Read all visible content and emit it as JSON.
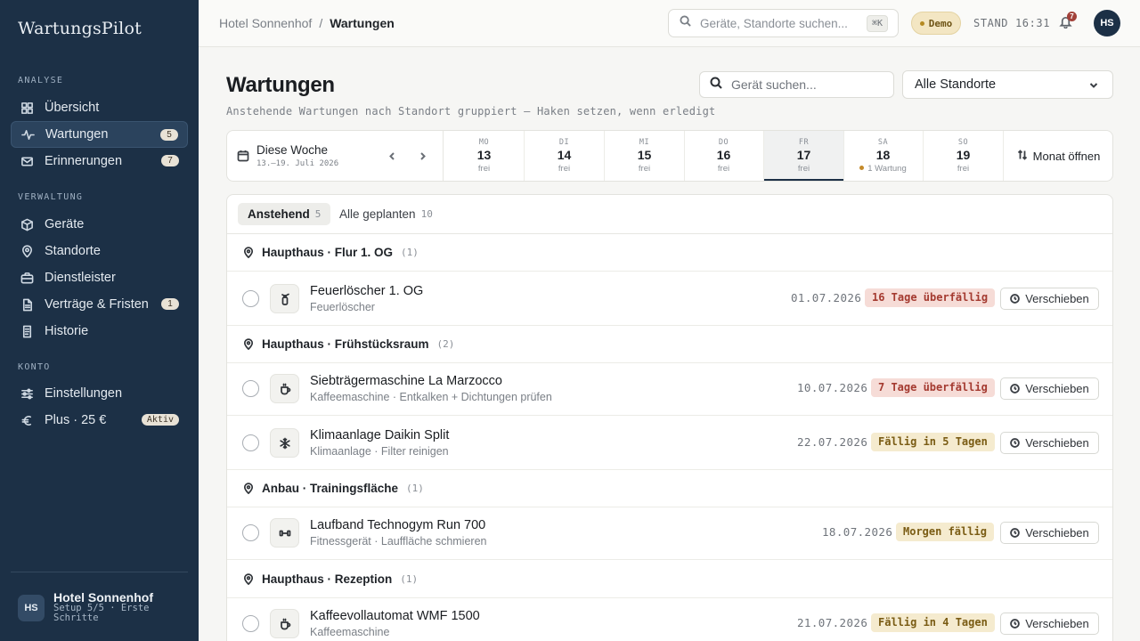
{
  "app": {
    "name": "WartungsPilot"
  },
  "sidebar": {
    "sections": [
      "ANALYSE",
      "VERWALTUNG",
      "KONTO"
    ],
    "items": [
      {
        "label": "Übersicht",
        "icon": "grid-icon"
      },
      {
        "label": "Wartungen",
        "icon": "activity-icon",
        "count": "5",
        "active": true
      },
      {
        "label": "Erinnerungen",
        "icon": "mail-icon",
        "count": "7"
      },
      {
        "label": "Geräte",
        "icon": "box-icon"
      },
      {
        "label": "Standorte",
        "icon": "map-pin-icon"
      },
      {
        "label": "Dienstleister",
        "icon": "briefcase-icon"
      },
      {
        "label": "Verträge & Fristen",
        "icon": "document-icon",
        "count": "1"
      },
      {
        "label": "Historie",
        "icon": "history-icon"
      },
      {
        "label": "Einstellungen",
        "icon": "sliders-icon"
      },
      {
        "label": "Plus · 25 €",
        "icon": "euro-icon",
        "pill": "Aktiv"
      }
    ],
    "user": {
      "initials": "HS",
      "name": "Hotel Sonnenhof",
      "sub": "Setup 5/5 · Erste Schritte"
    }
  },
  "topbar": {
    "breadcrumb": [
      "Hotel Sonnenhof",
      "/",
      "Wartungen"
    ],
    "search_placeholder": "Geräte, Standorte suchen...",
    "shortcut": "⌘K",
    "demo_label": "Demo",
    "status_time": "STAND 16:31",
    "notifications": "7",
    "avatar": "HS"
  },
  "page": {
    "title": "Wartungen",
    "subtitle": "Anstehende Wartungen nach Standort gruppiert — Haken setzen, wenn erledigt",
    "device_search_placeholder": "Gerät suchen...",
    "location_select": "Alle Standorte"
  },
  "week": {
    "label": "Diese Woche",
    "range": "13.–19. Juli 2026",
    "days": [
      {
        "wd": "MO",
        "num": "13",
        "status": "frei"
      },
      {
        "wd": "DI",
        "num": "14",
        "status": "frei"
      },
      {
        "wd": "MI",
        "num": "15",
        "status": "frei"
      },
      {
        "wd": "DO",
        "num": "16",
        "status": "frei"
      },
      {
        "wd": "FR",
        "num": "17",
        "status": "frei",
        "selected": true
      },
      {
        "wd": "SA",
        "num": "18",
        "status": "1 Wartung",
        "dot": true
      },
      {
        "wd": "SO",
        "num": "19",
        "status": "frei"
      }
    ],
    "month_button": "Monat öffnen"
  },
  "tabs": [
    {
      "label": "Anstehend",
      "count": "5",
      "active": true
    },
    {
      "label": "Alle geplanten",
      "count": "10"
    }
  ],
  "groups": [
    {
      "name": "Haupthaus · Flur 1. OG",
      "count": "(1)",
      "items": [
        {
          "name": "Feuerlöscher 1. OG",
          "desc": "Feuerlöscher",
          "icon": "fire-extinguisher-icon",
          "date": "01.07.2026",
          "due": "16 Tage überfällig",
          "tone": "red",
          "action": "Verschieben"
        }
      ]
    },
    {
      "name": "Haupthaus · Frühstücksraum",
      "count": "(2)",
      "items": [
        {
          "name": "Siebträgermaschine La Marzocco",
          "desc": "Kaffeemaschine · Entkalken + Dichtungen prüfen",
          "icon": "coffee-icon",
          "date": "10.07.2026",
          "due": "7 Tage überfällig",
          "tone": "red",
          "action": "Verschieben"
        },
        {
          "name": "Klimaanlage Daikin Split",
          "desc": "Klimaanlage · Filter reinigen",
          "icon": "snowflake-icon",
          "date": "22.07.2026",
          "due": "Fällig in 5 Tagen",
          "tone": "amb",
          "action": "Verschieben"
        }
      ]
    },
    {
      "name": "Anbau · Trainingsfläche",
      "count": "(1)",
      "items": [
        {
          "name": "Laufband Technogym Run 700",
          "desc": "Fitnessgerät · Lauffläche schmieren",
          "icon": "dumbbell-icon",
          "date": "18.07.2026",
          "due": "Morgen fällig",
          "tone": "amb",
          "action": "Verschieben"
        }
      ]
    },
    {
      "name": "Haupthaus · Rezeption",
      "count": "(1)",
      "items": [
        {
          "name": "Kaffeevollautomat WMF 1500",
          "desc": "Kaffeemaschine",
          "icon": "coffee-icon",
          "date": "21.07.2026",
          "due": "Fällig in 4 Tagen",
          "tone": "amb",
          "action": "Verschieben"
        }
      ]
    }
  ],
  "colors": {
    "sidebar_bg": "#1c3046",
    "overdue": "#a43a30",
    "due_soon": "#7a5c14"
  }
}
